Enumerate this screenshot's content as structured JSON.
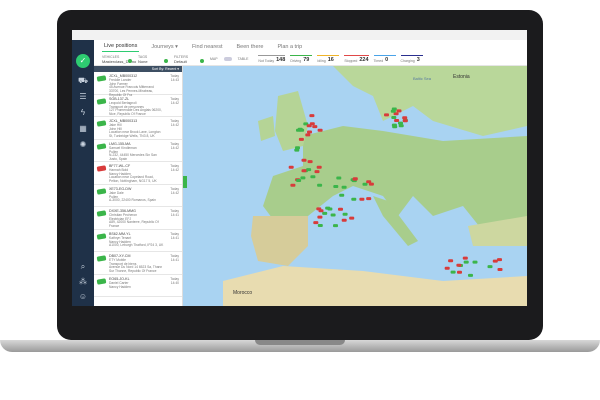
{
  "tabs": [
    "Live positions",
    "Journeys ▾",
    "Find nearest",
    "Been there",
    "Plan a trip"
  ],
  "filters": [
    {
      "label": "VEHICLES",
      "value": "Masterclass_Demo"
    },
    {
      "label": "TAGS",
      "value": "None"
    },
    {
      "label": "FILTERS",
      "value": "Default"
    }
  ],
  "view_toggle": {
    "map": "MAP",
    "table": "TABLE"
  },
  "stats": [
    {
      "label": "Not Today",
      "value": "148",
      "color": "#999999"
    },
    {
      "label": "Driving",
      "value": "79",
      "color": "#3bb54a"
    },
    {
      "label": "Idling",
      "value": "16",
      "color": "#f0b429"
    },
    {
      "label": "Stopped",
      "value": "224",
      "color": "#e04848"
    },
    {
      "label": "Timed",
      "value": "0",
      "color": "#4aa3e8"
    },
    {
      "label": "Charging",
      "value": "3",
      "color": "#2a2f8f"
    }
  ],
  "list": {
    "sort": "Sort By: Recent ▾",
    "items": [
      {
        "name": "JCXL_MB000312",
        "sub": "Freddie Lander",
        "driver": "John Farmer",
        "addr": "45 Avenue Francois Mitterrand 33700, Les Pennes-Mirabeau, Republic Of Fra",
        "time": "Today",
        "clock": "14:43",
        "status": "green"
      },
      {
        "name": "SGB-137-ZL",
        "sub": "Leopold Bertagnoli",
        "driver": "Transport de personnes",
        "addr": "127 Promenade Des Anglais 06200, Nice, Republic Of France",
        "time": "Today",
        "clock": "14:42",
        "status": "green"
      },
      {
        "name": "JCXL_MB000313",
        "sub": "Jake Hill",
        "driver": "John Hill",
        "addr": "Location near Brook Lane, Longton St, Tunbridge Wells, TN3 8, UK",
        "time": "Today",
        "clock": "14:42",
        "status": "green"
      },
      {
        "name": "LMG-155-MA",
        "sub": "Samuel Kindleman",
        "driver": "Pullen",
        "addr": "N-232, 44450 Mercedes Sin San Justo, Spain",
        "time": "Today",
        "clock": "14:42",
        "status": "green"
      },
      {
        "name": "BF77-WL-CF",
        "sub": "Hannah Bold",
        "driver": "Nancy Hadden",
        "addr": "Location near Copeland Road, Pelton, Nottingham, NG17 5, UK",
        "time": "Today",
        "clock": "14:42",
        "status": "red"
      },
      {
        "name": "XE73-EG-DW",
        "sub": "Jake Dale",
        "driver": "Pullen",
        "addr": "A-3000, 22400 Romanos, Spain",
        "time": "Today",
        "clock": "14:42",
        "status": "green"
      },
      {
        "name": "DXXE-356-MMG",
        "sub": "Christian Pecheron",
        "driver": "Electrician EFJ",
        "addr": "A89, 42000 Nanterre, Republic Of France",
        "time": "Today",
        "clock": "14:41",
        "status": "green"
      },
      {
        "name": "BS62-MM-YL",
        "sub": "Kathryn Tenant",
        "driver": "Nancy Hadden",
        "addr": "A1000, Leburgh Thatford, IP24 3, UK",
        "time": "Today",
        "clock": "14:41",
        "status": "green"
      },
      {
        "name": "DB07-XY-CM",
        "sub": "ETY Mobile",
        "driver": "Transport de biens",
        "addr": "Avenue Du Nord 14 6523 Sa, Thann Sur Thonne, Republic Of France",
        "time": "Today",
        "clock": "14:41",
        "status": "green"
      },
      {
        "name": "EO65-JO-KL",
        "sub": "Daniel Carter",
        "driver": "Nancy Hadden",
        "addr": "",
        "time": "Today",
        "clock": "14:40",
        "status": "green"
      }
    ]
  },
  "map": {
    "labels": [
      "Estonia",
      "Baltic Sea",
      "Morocco"
    ]
  }
}
